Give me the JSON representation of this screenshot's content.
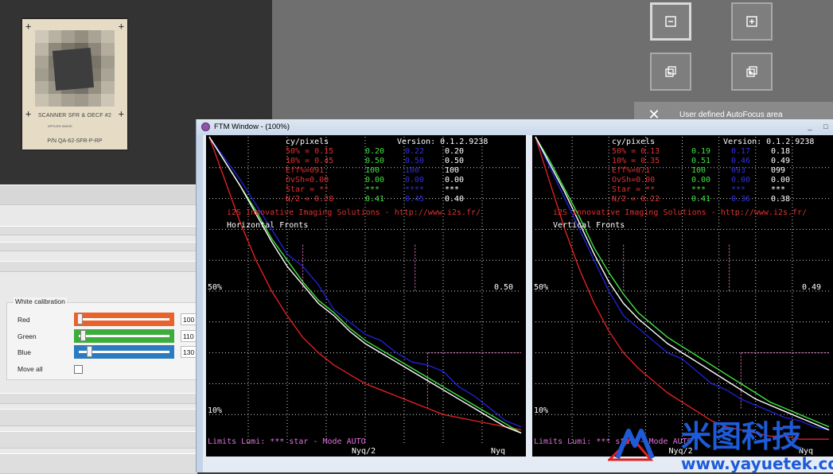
{
  "target": {
    "title": "SCANNER SFR & OECF #2",
    "small_text": "APPLIED IMAGE",
    "code": "P/N QA-62-SFR-P-RP",
    "patch_tones": [
      "#cfc8b8",
      "#b9b2a3",
      "#a59f91",
      "#948e81",
      "#a9a395",
      "#c3bcad",
      "#bdb6a7",
      "#8f897c",
      "#7a7569",
      "#6e695e",
      "#8c877a",
      "#b4ad9e",
      "#aaa495",
      "#7f7a6e",
      "#5a564d",
      "#4f4b43",
      "#7a7569",
      "#a19b8d",
      "#a29c8e",
      "#858074",
      "#5f5b52",
      "#56524a",
      "#807b6f",
      "#aaa496",
      "#b5af9f",
      "#9b9588",
      "#7e796d",
      "#77726a",
      "#958f82",
      "#bbb4a4",
      "#c8c1b1",
      "#b7b0a1",
      "#a6a092",
      "#9f998b",
      "#b0aa9b",
      "#cdc5b5"
    ]
  },
  "toolbar": {
    "zoom_out_label": "zoom out",
    "zoom_in_label": "zoom in",
    "fit_label": "fit",
    "full_label": "full"
  },
  "autofocus": {
    "label": "User defined AutoFocus area",
    "close": "✕"
  },
  "white_calibration": {
    "title": "White calibration",
    "red": {
      "label": "Red",
      "value": "100",
      "level": 0.0,
      "color": "#e8622c"
    },
    "green": {
      "label": "Green",
      "value": "110",
      "level": 0.04,
      "color": "#3cad3c"
    },
    "blue": {
      "label": "Blue",
      "value": "130",
      "level": 0.11,
      "color": "#2a7bc0"
    },
    "move_all": "Move all"
  },
  "ftm_window": {
    "title": "FTM Window - (100%)",
    "minimize": "_",
    "maximize": "□"
  },
  "plots": [
    {
      "header": "cy/pixels",
      "version": "Version: 0.1.2.9238",
      "rows": [
        {
          "label": "50% = 0.15",
          "green": "0.20",
          "blue": "0.22",
          "white": "0.20"
        },
        {
          "label": "10% = 0.45",
          "green": "0.50",
          "blue": "0.50",
          "white": "0.50"
        },
        {
          "label": "Eff%=091",
          "green": "100",
          "blue": "100",
          "white": "100"
        },
        {
          "label": "OvSh=0.00",
          "green": "0.00",
          "blue": "0.00",
          "white": "0.00"
        },
        {
          "label": "Star = **",
          "green": "***",
          "blue": "****",
          "white": "***"
        },
        {
          "label": "N/2 = 0.28",
          "green": "0.41",
          "blue": "0.45",
          "white": "0.40"
        }
      ],
      "company": "i2S Innovative Imaging Solutions - http://www.i2s.fr/",
      "orientation": "Horizontal Fronts",
      "pct50": "50%",
      "pct10": "10%",
      "right50": "0.50",
      "footer": "Limits Lumi: *** star   - Mode AUTO",
      "nyq2": "Nyq/2",
      "nyq": "Nyq"
    },
    {
      "header": "cy/pixels",
      "version": "Version: 0.1.2.9238",
      "rows": [
        {
          "label": "50% = 0.13",
          "green": "0.19",
          "blue": "0.17",
          "white": "0.18"
        },
        {
          "label": "10% = 0.35",
          "green": "0.51",
          "blue": "0.46",
          "white": "0.49"
        },
        {
          "label": "Eff%=071",
          "green": "100",
          "blue": "093",
          "white": "099"
        },
        {
          "label": "OvSh=0.00",
          "green": "0.00",
          "blue": "0.00",
          "white": "0.00"
        },
        {
          "label": "Star = **",
          "green": "***",
          "blue": "***",
          "white": "***"
        },
        {
          "label": "N/2 = 0.22",
          "green": "0.41",
          "blue": "0.36",
          "white": "0.38"
        }
      ],
      "company": "i2S Innovative Imaging Solutions - http://www.i2s.fr/",
      "orientation": "Vertical Fronts",
      "pct50": "50%",
      "pct10": "10%",
      "right50": "0.49",
      "footer": "Limits Lumi: *** star   - Mode AUTO",
      "nyq2": "Nyq/2",
      "nyq": "Nyq"
    }
  ],
  "chart_data": [
    {
      "type": "line",
      "title": "Horizontal Fronts",
      "xlabel": "",
      "ylabel": "",
      "x_range": [
        0,
        1
      ],
      "ylim": [
        0,
        1
      ],
      "grid": true,
      "x": [
        0,
        0.05,
        0.1,
        0.15,
        0.2,
        0.25,
        0.3,
        0.35,
        0.4,
        0.45,
        0.5,
        0.55,
        0.6,
        0.65,
        0.7,
        0.75,
        0.8,
        0.85,
        0.9,
        0.95,
        1.0
      ],
      "series": [
        {
          "color": "#e02020",
          "values": [
            1.0,
            0.86,
            0.72,
            0.6,
            0.5,
            0.42,
            0.35,
            0.3,
            0.26,
            0.23,
            0.2,
            0.18,
            0.16,
            0.14,
            0.12,
            0.1,
            0.09,
            0.08,
            0.07,
            0.06,
            0.05
          ]
        },
        {
          "color": "#40e040",
          "values": [
            1.0,
            0.92,
            0.84,
            0.76,
            0.67,
            0.6,
            0.53,
            0.47,
            0.43,
            0.38,
            0.34,
            0.31,
            0.28,
            0.25,
            0.22,
            0.19,
            0.16,
            0.13,
            0.1,
            0.07,
            0.04
          ]
        },
        {
          "color": "#2020d0",
          "values": [
            1.0,
            0.93,
            0.86,
            0.78,
            0.7,
            0.62,
            0.58,
            0.52,
            0.44,
            0.4,
            0.36,
            0.34,
            0.3,
            0.27,
            0.26,
            0.24,
            0.19,
            0.16,
            0.12,
            0.08,
            0.06
          ]
        },
        {
          "color": "#ffffff",
          "values": [
            1.0,
            0.92,
            0.84,
            0.75,
            0.66,
            0.58,
            0.52,
            0.46,
            0.42,
            0.37,
            0.33,
            0.3,
            0.27,
            0.24,
            0.21,
            0.18,
            0.15,
            0.12,
            0.09,
            0.06,
            0.04
          ]
        }
      ]
    },
    {
      "type": "line",
      "title": "Vertical Fronts",
      "xlabel": "",
      "ylabel": "",
      "x_range": [
        0,
        1
      ],
      "ylim": [
        0,
        1
      ],
      "grid": true,
      "x": [
        0,
        0.05,
        0.1,
        0.15,
        0.2,
        0.25,
        0.3,
        0.35,
        0.4,
        0.45,
        0.5,
        0.55,
        0.6,
        0.65,
        0.7,
        0.75,
        0.8,
        0.85,
        0.9,
        0.95,
        1.0
      ],
      "series": [
        {
          "color": "#e02020",
          "values": [
            1.0,
            0.85,
            0.7,
            0.57,
            0.46,
            0.37,
            0.3,
            0.25,
            0.21,
            0.17,
            0.14,
            0.11,
            0.08,
            0.06,
            0.05,
            0.04,
            0.03,
            0.03,
            0.02,
            0.02,
            0.02
          ]
        },
        {
          "color": "#40e040",
          "values": [
            1.0,
            0.92,
            0.83,
            0.74,
            0.64,
            0.56,
            0.49,
            0.43,
            0.39,
            0.35,
            0.32,
            0.29,
            0.26,
            0.23,
            0.2,
            0.17,
            0.14,
            0.12,
            0.1,
            0.08,
            0.06
          ]
        },
        {
          "color": "#2020d0",
          "values": [
            1.0,
            0.9,
            0.8,
            0.7,
            0.6,
            0.5,
            0.42,
            0.38,
            0.34,
            0.3,
            0.28,
            0.24,
            0.2,
            0.18,
            0.15,
            0.13,
            0.11,
            0.09,
            0.08,
            0.06,
            0.05
          ]
        },
        {
          "color": "#ffffff",
          "values": [
            1.0,
            0.91,
            0.82,
            0.72,
            0.62,
            0.53,
            0.46,
            0.41,
            0.37,
            0.33,
            0.3,
            0.27,
            0.24,
            0.21,
            0.18,
            0.15,
            0.13,
            0.11,
            0.09,
            0.07,
            0.05
          ]
        }
      ]
    }
  ],
  "watermark": {
    "brand": "米图科技",
    "url": "www.yayuetek.com",
    "color": "#1e5bd8"
  }
}
